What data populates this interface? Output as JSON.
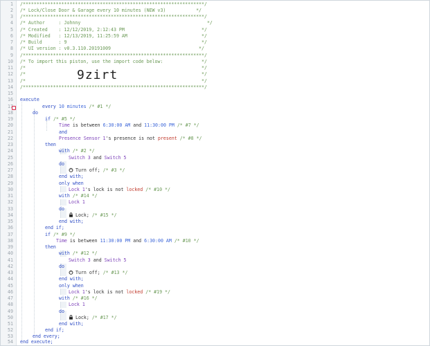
{
  "header": {
    "border": "/******************************************************************/",
    "title": "/* Lock/Close Door & Garage every 10 minutes (NEW v3)           */",
    "author": "/* Author     : Johnny                                              */",
    "created": "/* Created    : 12/12/2019, 2:12:43 PM                            */",
    "modified": "/* Modified   : 12/13/2019, 11:25:59 AM                           */",
    "build": "/* Build      : 9                                                 */",
    "ui_version": "/* UI version : v0.3.110.20191009                                */",
    "import_note": "/* To import this piston, use the import code below:              */",
    "blank": "/*                                                                */",
    "import_code": "9zirt"
  },
  "code": {
    "execute": "execute",
    "every": "every",
    "every_val": "10 minutes",
    "c1": "/* #1 */",
    "do": "do",
    "if": "if",
    "c5": "/* #5 */",
    "time": "Time",
    "is_between": "is between",
    "t1": "6:30:00 AM",
    "and": "and",
    "t2": "11:30:00 PM",
    "c7": "/* #7 */",
    "presence_dev": "Presence Sensor 1",
    "presence_attr": "'s presence",
    "is_not": "is not",
    "present": "present",
    "c8": "/* #8 */",
    "then": "then",
    "with": "with",
    "c2": "/* #2 */",
    "sw3": "Switch 3",
    "sw5": "Switch 5",
    "turn_off": "Turn off;",
    "c3": "/* #3 */",
    "end_with": "end with;",
    "only_when": "only when",
    "lock1": "Lock 1",
    "lock_attr": "'s lock",
    "locked": "locked",
    "c10": "/* #10 */",
    "c14": "/* #14 */",
    "lock_cmd": "Lock;",
    "c15": "/* #15 */",
    "end_if": "end if;",
    "c9": "/* #9 */",
    "t3": "11:30:00 PM",
    "t4": "6:30:00 AM",
    "c10b": "/* #10 */",
    "c12": "/* #12 */",
    "c13": "/* #13 */",
    "c19": "/* #19 */",
    "c16": "/* #16 */",
    "c17": "/* #17 */",
    "end_every": "end every;",
    "end_execute": "end execute;"
  },
  "colors": {
    "comment": "#6a9955",
    "keyword": "#2c4bc4",
    "value": "#3a64d8",
    "device": "#7b3fb8",
    "string": "#c0392b",
    "gutter": "#f3f5f7"
  },
  "icons": [
    "power-icon",
    "lock-icon"
  ]
}
